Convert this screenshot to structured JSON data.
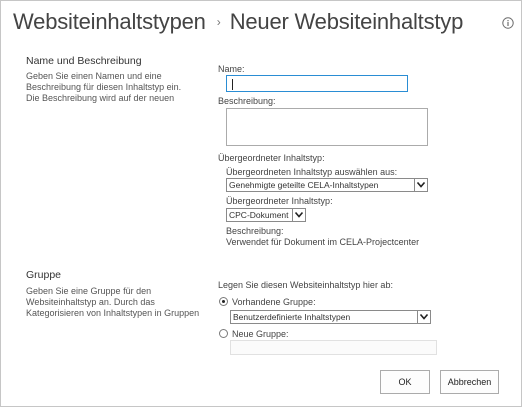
{
  "header": {
    "breadcrumb_parent": "Websiteinhaltstypen",
    "separator": "›",
    "page_title": "Neuer Websiteinhaltstyp",
    "info_icon": "info-icon"
  },
  "name_section": {
    "title": "Name und Beschreibung",
    "description": "Geben Sie einen Namen und eine Beschreibung für diesen Inhaltstyp ein. Die Beschreibung wird auf der neuen",
    "name_label": "Name:",
    "name_value": "",
    "description_label": "Beschreibung:",
    "description_value": "",
    "parent_label": "Übergeordneter Inhaltstyp:",
    "select_from_label": "Übergeordneten Inhaltstyp auswählen aus:",
    "select_from_value": "Genehmigte geteilte CELA-Inhaltstypen",
    "parent_type_label": "Übergeordneter Inhaltstyp:",
    "parent_type_value": "CPC-Dokument",
    "parent_desc_label": "Beschreibung:",
    "parent_desc_text": "Verwendet für Dokument im CELA-Projectcenter"
  },
  "group_section": {
    "title": "Gruppe",
    "description": "Geben Sie eine Gruppe für den Websiteinhaltstyp an. Durch das Kategorisieren von Inhaltstypen in Gruppen",
    "put_in_label": "Legen Sie diesen Websiteinhaltstyp hier ab:",
    "existing_group_label": "Vorhandene Gruppe:",
    "existing_group_selected": true,
    "existing_group_value": "Benutzerdefinierte Inhaltstypen",
    "new_group_label": "Neue Gruppe:",
    "new_group_value": ""
  },
  "buttons": {
    "ok_label": "OK",
    "cancel_label": "Abbrechen"
  }
}
